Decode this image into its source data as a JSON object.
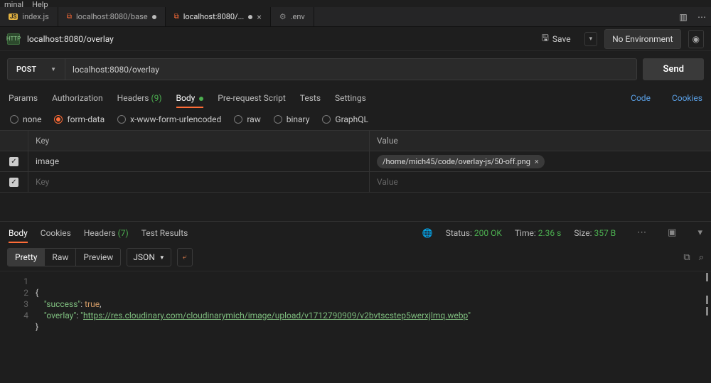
{
  "menu": {
    "items": [
      "minal",
      "Help"
    ]
  },
  "editorTabs": {
    "items": [
      {
        "label": "index.js",
        "kind": "js",
        "modified": false,
        "active": false
      },
      {
        "label": "localhost:8080/base",
        "kind": "pm",
        "modified": true,
        "active": false
      },
      {
        "label": "localhost:8080/...",
        "kind": "pm",
        "modified": true,
        "active": true
      },
      {
        "label": ".env",
        "kind": "env",
        "modified": false,
        "active": false
      }
    ]
  },
  "request": {
    "title": "localhost:8080/overlay",
    "save_label": "Save",
    "env_label": "No Environment",
    "method": "POST",
    "url": "localhost:8080/overlay",
    "send_label": "Send"
  },
  "reqTabs": {
    "params": "Params",
    "auth": "Authorization",
    "headers": "Headers",
    "headers_count": "(9)",
    "body": "Body",
    "prerequest": "Pre-request Script",
    "tests": "Tests",
    "settings": "Settings",
    "code": "Code",
    "cookies": "Cookies"
  },
  "bodyTypes": {
    "none": "none",
    "formdata": "form-data",
    "urlencoded": "x-www-form-urlencoded",
    "raw": "raw",
    "binary": "binary",
    "graphql": "GraphQL"
  },
  "kv": {
    "key_header": "Key",
    "value_header": "Value",
    "rows": [
      {
        "checked": true,
        "key": "image",
        "file": "/home/mich45/code/overlay-js/50-off.png"
      }
    ],
    "key_placeholder": "Key",
    "value_placeholder": "Value"
  },
  "respTabs": {
    "body": "Body",
    "cookies": "Cookies",
    "headers": "Headers",
    "headers_count": "(7)",
    "tests": "Test Results"
  },
  "respMeta": {
    "status_label": "Status:",
    "status_value": "200 OK",
    "time_label": "Time:",
    "time_value": "2.36 s",
    "size_label": "Size:",
    "size_value": "357 B"
  },
  "viewRow": {
    "pretty": "Pretty",
    "raw": "Raw",
    "preview": "Preview",
    "lang": "JSON"
  },
  "code": {
    "lines": [
      "1",
      "2",
      "3",
      "4"
    ],
    "l1": "{",
    "l2_key": "\"success\"",
    "l2_colon": ": ",
    "l2_val": "true",
    "l2_comma": ",",
    "l3_key": "\"overlay\"",
    "l3_colon": ": ",
    "l3_q": "\"",
    "l3_url": "https://res.cloudinary.com/cloudinarymich/image/upload/v1712790909/v2bvtscstep5werxjlmq.webp",
    "l3_end": "\"",
    "l4": "}"
  }
}
